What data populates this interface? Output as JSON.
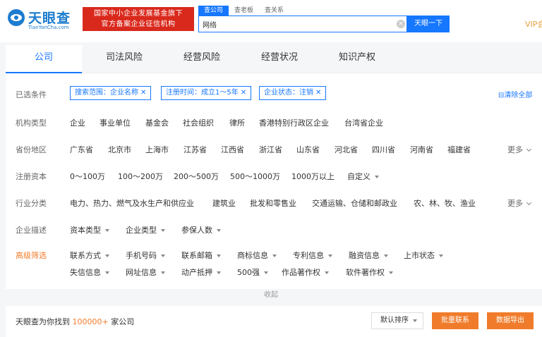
{
  "header": {
    "logo_name": "天眼查",
    "logo_sub": "TianYanCha.com",
    "badge_line1": "国家中小企业发展基金旗下",
    "badge_line2": "官方备案企业征信机构",
    "search_tabs": [
      "查公司",
      "查老板",
      "查关系"
    ],
    "search_value": "网络",
    "clear_icon": "×",
    "search_button": "天眼一下",
    "vip": "VIP会员"
  },
  "tabs": [
    "公司",
    "司法风险",
    "经营风险",
    "经营状况",
    "知识产权"
  ],
  "filters": {
    "selected_label": "已选条件",
    "selected_chips": [
      "搜索范围：企业名称",
      "注册时间：成立1～5年",
      "企业状态：注销"
    ],
    "chip_close": "✕",
    "clear_all": "清除全部",
    "org_label": "机构类型",
    "org_options": [
      "企业",
      "事业单位",
      "基金会",
      "社会组织",
      "律所",
      "香港特别行政区企业",
      "台湾省企业"
    ],
    "province_label": "省份地区",
    "province_options": [
      "广东省",
      "北京市",
      "上海市",
      "江苏省",
      "江西省",
      "浙江省",
      "山东省",
      "河北省",
      "四川省",
      "河南省",
      "福建省"
    ],
    "more": "更多",
    "capital_label": "注册资本",
    "capital_options": [
      "0～100万",
      "100～200万",
      "200～500万",
      "500～1000万",
      "1000万以上",
      "自定义"
    ],
    "industry_label": "行业分类",
    "industry_options": [
      "电力、热力、燃气及水生产和供应业",
      "建筑业",
      "批发和零售业",
      "交通运输、仓储和邮政业",
      "农、林、牧、渔业"
    ],
    "desc_label": "企业描述",
    "desc_options": [
      "资本类型",
      "企业类型",
      "参保人数"
    ],
    "adv_label": "高级筛选",
    "adv_row1": [
      "联系方式",
      "手机号码",
      "联系邮箱",
      "商标信息",
      "专利信息",
      "融资信息",
      "上市状态"
    ],
    "adv_row2": [
      "失信信息",
      "网址信息",
      "动产抵押",
      "500强",
      "作品著作权",
      "软件著作权"
    ]
  },
  "collapse": "收起",
  "result": {
    "prefix": "天眼查为你找到",
    "count": "100000+",
    "suffix": "家公司",
    "sort": "默认排序",
    "batch_contact": "批量联系",
    "export": "数据导出"
  },
  "colors": {
    "brand": "#1677ff",
    "accent": "#f07c2b",
    "badge": "#d9291c"
  }
}
